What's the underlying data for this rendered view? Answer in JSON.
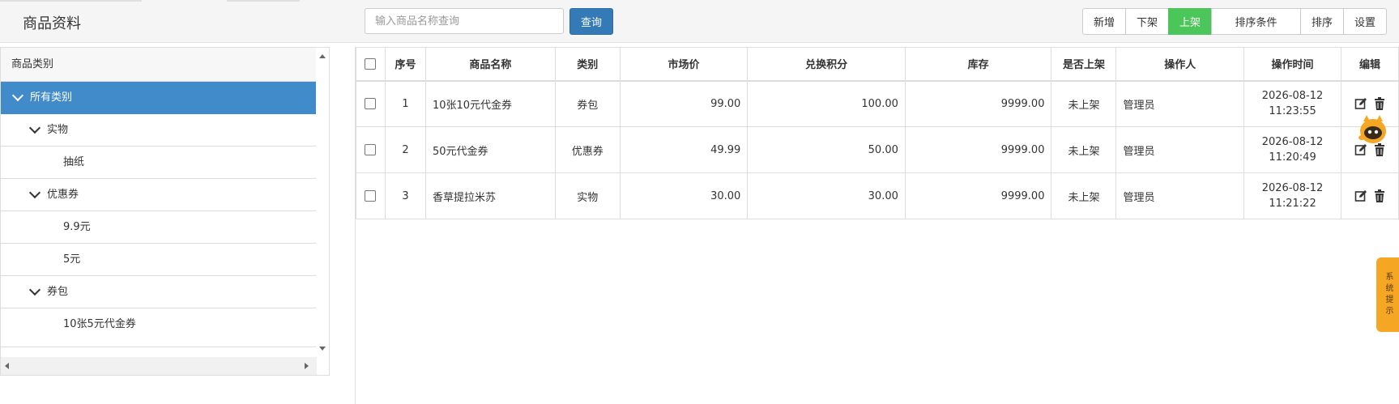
{
  "header": {
    "title": "商品资料",
    "search_placeholder": "输入商品名称查询",
    "search_value": "",
    "query_label": "查询"
  },
  "toolbar": {
    "buttons": [
      {
        "label": "新增",
        "active": false
      },
      {
        "label": "下架",
        "active": false
      },
      {
        "label": "上架",
        "active": true
      },
      {
        "label": "排序条件",
        "active": false
      },
      {
        "label": "排序",
        "active": false
      },
      {
        "label": "设置",
        "active": false
      }
    ],
    "active_color": "#4cc55a"
  },
  "tree": {
    "header": "商品类别",
    "nodes": [
      {
        "label": "所有类别",
        "level": 0,
        "expanded": true,
        "selected": true
      },
      {
        "label": "实物",
        "level": 1,
        "expanded": true,
        "selected": false
      },
      {
        "label": "抽纸",
        "level": 2,
        "expanded": false,
        "selected": false
      },
      {
        "label": "优惠券",
        "level": 1,
        "expanded": true,
        "selected": false
      },
      {
        "label": "9.9元",
        "level": 2,
        "expanded": false,
        "selected": false
      },
      {
        "label": "5元",
        "level": 2,
        "expanded": false,
        "selected": false
      },
      {
        "label": "券包",
        "level": 1,
        "expanded": true,
        "selected": false
      },
      {
        "label": "10张5元代金券",
        "level": 2,
        "expanded": false,
        "selected": false
      }
    ],
    "selected_color": "#428bca"
  },
  "table": {
    "columns": [
      "",
      "序号",
      "商品名称",
      "类别",
      "市场价",
      "兑换积分",
      "库存",
      "是否上架",
      "操作人",
      "操作时间",
      "编辑"
    ],
    "rows": [
      {
        "no": "1",
        "name": "10张10元代金券",
        "category": "券包",
        "price": "99.00",
        "points": "100.00",
        "stock": "9999.00",
        "listed": "未上架",
        "operator": "管理员",
        "date": "2026-08-12",
        "time": "11:23:55"
      },
      {
        "no": "2",
        "name": "50元代金券",
        "category": "优惠券",
        "price": "49.99",
        "points": "50.00",
        "stock": "9999.00",
        "listed": "未上架",
        "operator": "管理员",
        "date": "2026-08-12",
        "time": "11:20:49"
      },
      {
        "no": "3",
        "name": "香草提拉米苏",
        "category": "实物",
        "price": "30.00",
        "points": "30.00",
        "stock": "9999.00",
        "listed": "未上架",
        "operator": "管理员",
        "date": "2026-08-12",
        "time": "11:21:22"
      }
    ]
  },
  "side_tip": {
    "label": "系统提示",
    "color": "#f5a623"
  }
}
